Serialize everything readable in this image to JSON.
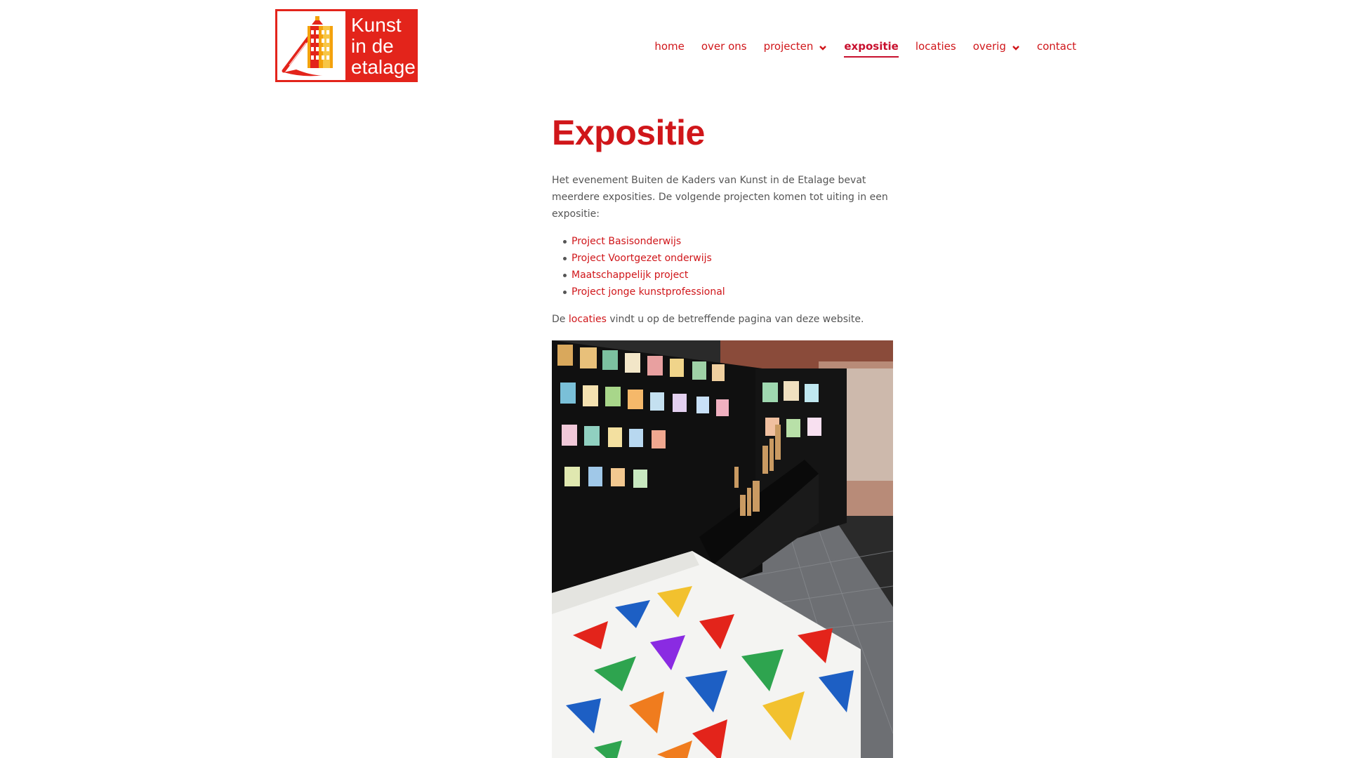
{
  "logo": {
    "line1": "Kunst",
    "line2": "in de",
    "line3": "etalage"
  },
  "nav": {
    "items": [
      {
        "label": "home",
        "dropdown": false,
        "active": false
      },
      {
        "label": "over ons",
        "dropdown": false,
        "active": false
      },
      {
        "label": "projecten",
        "dropdown": true,
        "active": false
      },
      {
        "label": "expositie",
        "dropdown": false,
        "active": true
      },
      {
        "label": "locaties",
        "dropdown": false,
        "active": false
      },
      {
        "label": "overig",
        "dropdown": true,
        "active": false
      },
      {
        "label": "contact",
        "dropdown": false,
        "active": false
      }
    ]
  },
  "main": {
    "title": "Expositie",
    "intro": "Het evenement Buiten de Kaders van Kunst in de Etalage bevat meerdere exposities. De volgende projecten komen tot uiting in een expositie:",
    "projects": [
      "Project Basisonderwijs",
      "Project Voortgezet onderwijs",
      "Maatschappelijk project",
      "Project jonge kunstprofessional"
    ],
    "outro": {
      "before": "De",
      "link": "locaties",
      "after": "vindt u op de betreffende pagina van deze website."
    }
  },
  "colors": {
    "accent": "#d0161a",
    "active": "#c8102e",
    "text": "#555555"
  },
  "icons": {
    "dropdown": "chevron-down-icon"
  }
}
